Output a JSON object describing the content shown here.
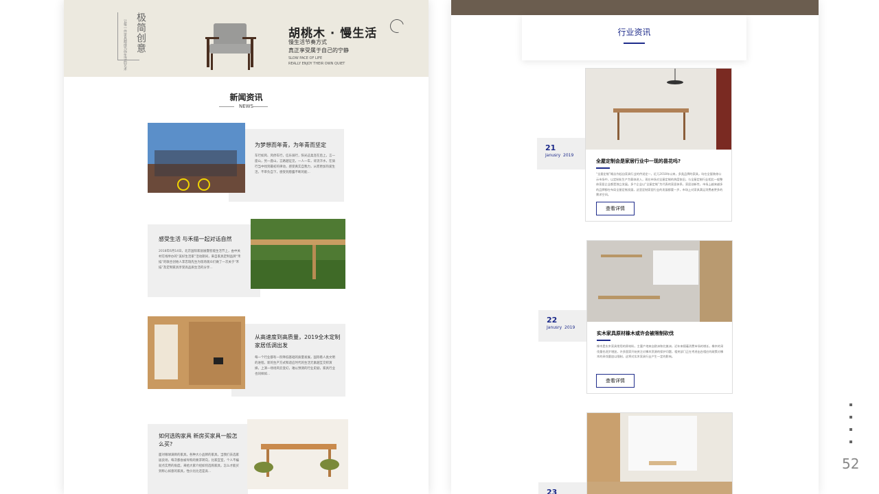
{
  "banner": {
    "vertical_text": "极简创意",
    "vertical_small": "让每一件家具都成为你生活的艺术",
    "title": "胡桃木 · 慢生活",
    "line1": "慢生活节奏方式",
    "line2": "真正享受属于自己的宁静",
    "en1": "SLOW PACE OF LIFE",
    "en2": "REALLY ENJOY THEIR OWN QUIET"
  },
  "news": {
    "title": "新闻资讯",
    "subtitle": "NEWS",
    "items": [
      {
        "title": "为梦想而年青，为年青而坚定",
        "body": "车行如风、风停车行，信乐骑行，阳光这柔连在后上，言一座山，另一座山，言路越征见，一人一车，背流汗水，在骑行当中找到最初的律动，感受真实自我力，从而更加热爱生活，不审负自下，感受到愿露不断的能..."
      },
      {
        "title": "感受生活 与禾描一起对话自然",
        "body": "2018年6月14日，北京国际家居展暨智能生活节上，由中关村在线举办的“美好生活家”活动期间，来自家具定制品牌“禾描”的联合创始人李忠瑞先生为现场观众们做了一次关于“禾描”及定制家具享受高品质生活的分享..."
      },
      {
        "title": "从高速度到高质量，2019全木定制家居低调出发",
        "body": "每一个行业都有一阶降低基础的质量发展，国际看人类文明的进程，新的生产方式和适应时代的生活元素越互交织演绎，上演一场场风云变幻，难以预测的行业史剧，家具行业也同样如..."
      },
      {
        "title": "如何选购家具 新房买家具一般怎么买?",
        "body": "面对眼球满目的家具，各种大小品牌的家具，当我们去选家居卖场，每次都会被导购的要求转向，比家宜室，个人不编就点实用的角度，来给大家介绍如何选购家具，怎么才能买到称心如意的家具，性价比比还是高..."
      }
    ]
  },
  "industry": {
    "title": "行业资讯",
    "cards": [
      {
        "day": "21",
        "month": "Janusry",
        "year": "2019",
        "title": "全屋定制会是家居行业中一现的昙花吗?",
        "body": "“全屋定制”概念作起自家具行业的传说定一，近几2018年以来，多类品牌的家具，均在全屋装修公示市场中，以定制化生产为载体进入，现在市场对全屋定制的热度依旧，与全屋定制行业相比一般整体家居企业都是独立发展。多个企业以“全屋定制”为代表的家居体系，家居创新性，市场上越来越多的品牌都在布局全屋定制发展，这里定制家居行业的发展都要一步，市场上对家具满足消费者更多的需求空间。",
        "button": "查看详情"
      },
      {
        "day": "22",
        "month": "Janusry",
        "year": "2019",
        "title": "实木家具原材橡木或许会被限制砍伐",
        "body": "橡木是实木家具常用的原材料，主要产地来自欧洲和北美洲，近年来随着消费市场的增长，橡木的采伐量也逐步增加，许多国家开始关注对橡木资源的保护问题，相关部门正在考虑出台相应的政策对橡木的采伐量加以限制，这将对实木家具行业产生一定的影响。",
        "button": "查看详情"
      },
      {
        "day": "23"
      }
    ]
  },
  "page_number": "52"
}
